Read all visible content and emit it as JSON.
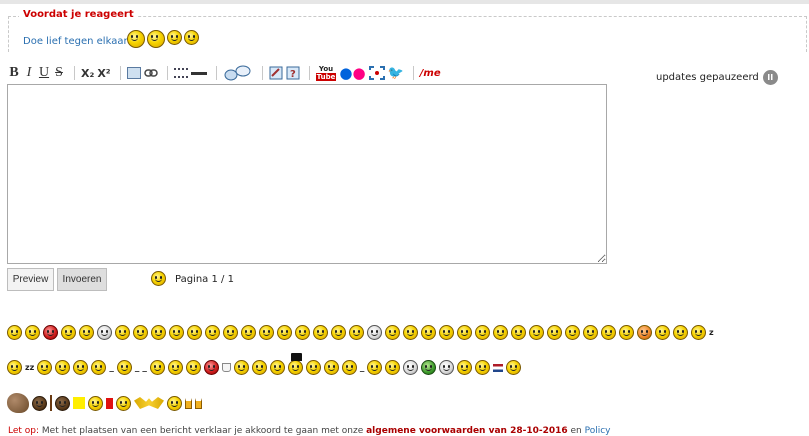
{
  "notice": {
    "legend": "Voordat je reageert",
    "text": "Doe lief tegen elkaar!"
  },
  "toolbar": {
    "bold": "B",
    "italic": "I",
    "underline": "U",
    "strike": "S",
    "subscript": "X₂",
    "superscript": "X²",
    "youtube_top": "You",
    "youtube_bottom": "Tube",
    "me": "/me"
  },
  "updates": {
    "label": "updates gepauzeerd",
    "pause_symbol": "II"
  },
  "editor": {
    "value": ""
  },
  "buttons": {
    "preview": "Preview",
    "submit": "Invoeren"
  },
  "pager": {
    "text": "Pagina 1 / 1"
  },
  "smileys": {
    "zz1": "z",
    "zz2": "zz",
    "underline1": "_",
    "underline2": "_",
    "underline3": "_",
    "underline4": "_"
  },
  "footer": {
    "warning": "Let op:",
    "text1": " Met het plaatsen van een bericht verklaar je akkoord te gaan met onze ",
    "terms": "algemene voorwaarden van 28-10-2016",
    "text2": " en ",
    "policy": "Policy"
  },
  "colors": {
    "accent_red": "#cc0000",
    "link_blue": "#2a6fb0",
    "smiley_yellow": "#f7d400"
  },
  "icons": [
    "bold",
    "italic",
    "underline",
    "strikethrough",
    "subscript",
    "superscript",
    "image-icon",
    "link-icon",
    "list-icon",
    "horizontal-rule-icon",
    "quote-icon",
    "spoiler-icon",
    "edit-icon",
    "help-icon",
    "youtube-icon",
    "flickr-icon",
    "fullscreen-icon",
    "twitter-icon",
    "me-icon",
    "pause-icon"
  ]
}
